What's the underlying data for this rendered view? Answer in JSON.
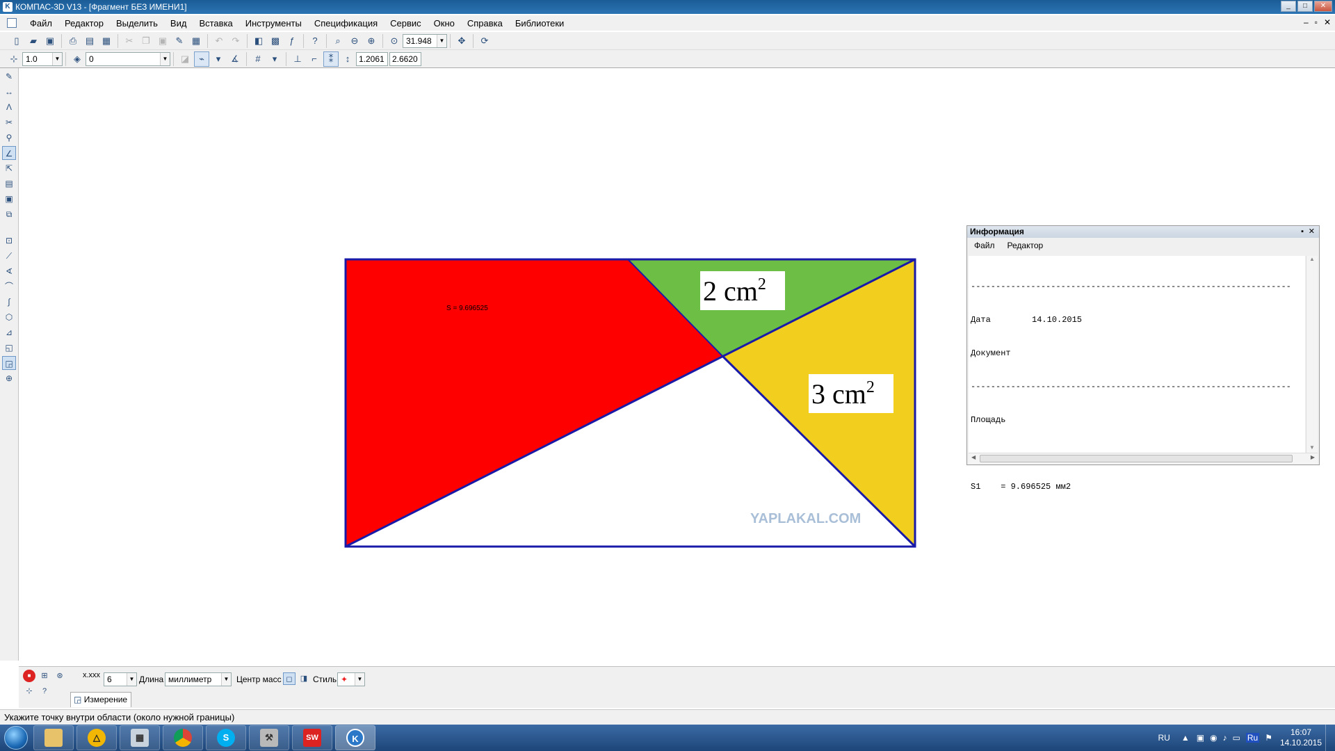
{
  "window": {
    "title": "КОМПАС-3D V13 - [Фрагмент БЕЗ ИМЕНИ1]"
  },
  "menu": [
    "Файл",
    "Редактор",
    "Выделить",
    "Вид",
    "Вставка",
    "Инструменты",
    "Спецификация",
    "Сервис",
    "Окно",
    "Справка",
    "Библиотеки"
  ],
  "toolbar": {
    "zoom": "31.948",
    "scale": "1.0",
    "layer": "0",
    "coord_x": "1.2061",
    "coord_y": "2.6620"
  },
  "drawing": {
    "area_label": "S = 9.696525",
    "label_green": "2 cm",
    "label_yellow": "3 cm",
    "superscript": "2",
    "watermark": "YAPLAKAL.COM",
    "colors": {
      "red": "#ff0000",
      "green": "#6cbe45",
      "yellow": "#f2cf1e",
      "edge": "#1a1aa8"
    }
  },
  "info_panel": {
    "title": "Информация",
    "menu": [
      "Файл",
      "Редактор"
    ],
    "divider": "----------------------------------------------------------------",
    "date_label": "Дата",
    "date_value": "14.10.2015",
    "document_label": "Документ",
    "area_heading": "Площадь",
    "result": "S1    = 9.696525 мм2"
  },
  "properties": {
    "precision_label": "x.xxx",
    "precision_value": "6",
    "length_label": "Длина",
    "unit": "миллиметр",
    "center_mass_label": "Центр масс",
    "style_label": "Стиль",
    "tab": "Измерение"
  },
  "status": "Укажите точку внутри области (около нужной границы)",
  "taskbar": {
    "lang": "RU",
    "time": "16:07",
    "date": "14.10.2015",
    "kb": "Ru"
  }
}
